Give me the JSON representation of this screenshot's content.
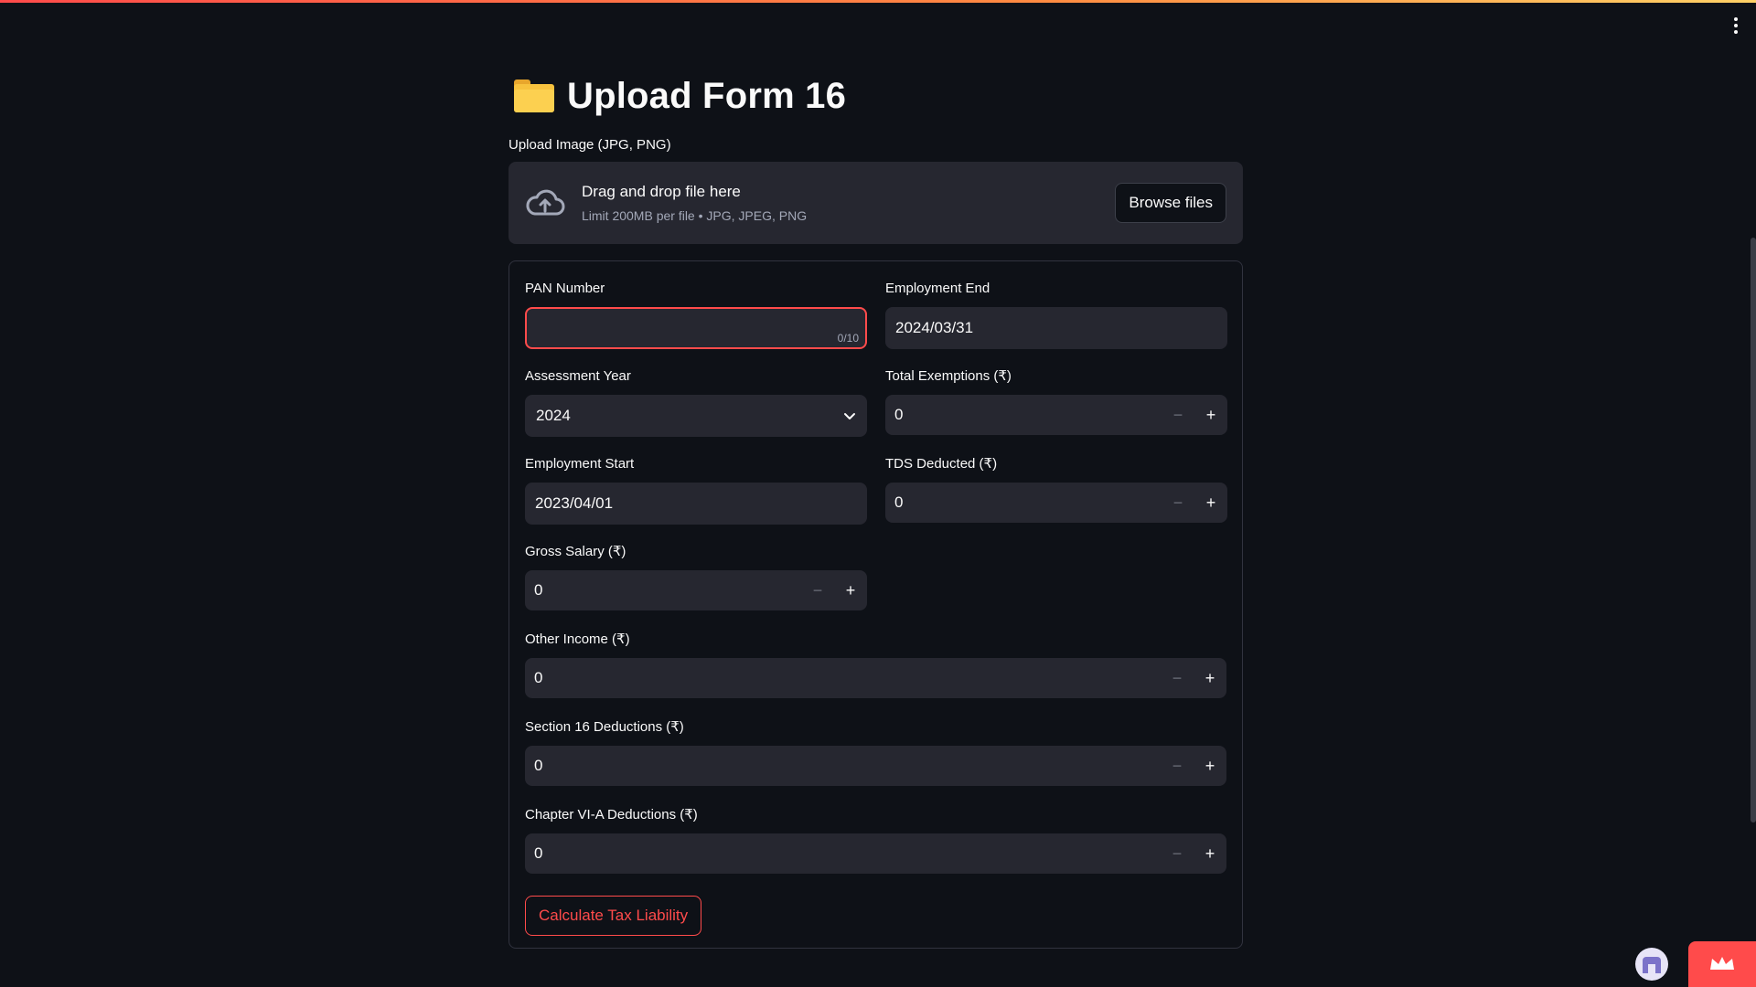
{
  "header": {
    "title_icon": "folder-icon",
    "title": "Upload Form 16"
  },
  "uploader": {
    "label": "Upload Image (JPG, PNG)",
    "drop_text": "Drag and drop file here",
    "limit_text": "Limit 200MB per file • JPG, JPEG, PNG",
    "browse_label": "Browse files"
  },
  "form": {
    "pan": {
      "label": "PAN Number",
      "value": "",
      "counter": "0/10"
    },
    "employment_end": {
      "label": "Employment End",
      "value": "2024/03/31"
    },
    "assessment_year": {
      "label": "Assessment Year",
      "value": "2024"
    },
    "total_exemptions": {
      "label": "Total Exemptions (₹)",
      "value": "0"
    },
    "employment_start": {
      "label": "Employment Start",
      "value": "2023/04/01"
    },
    "tds_deducted": {
      "label": "TDS Deducted (₹)",
      "value": "0"
    },
    "gross_salary": {
      "label": "Gross Salary (₹)",
      "value": "0"
    },
    "other_income": {
      "label": "Other Income (₹)",
      "value": "0"
    },
    "section16": {
      "label": "Section 16 Deductions (₹)",
      "value": "0"
    },
    "chapter6a": {
      "label": "Chapter VI-A Deductions (₹)",
      "value": "0"
    },
    "submit_label": "Calculate Tax Liability"
  },
  "stepper": {
    "minus": "−",
    "plus": "+"
  },
  "colors": {
    "background": "#0e1117",
    "input_bg": "#262730",
    "accent": "#ff4b4b",
    "folder": "#f7c23e"
  }
}
